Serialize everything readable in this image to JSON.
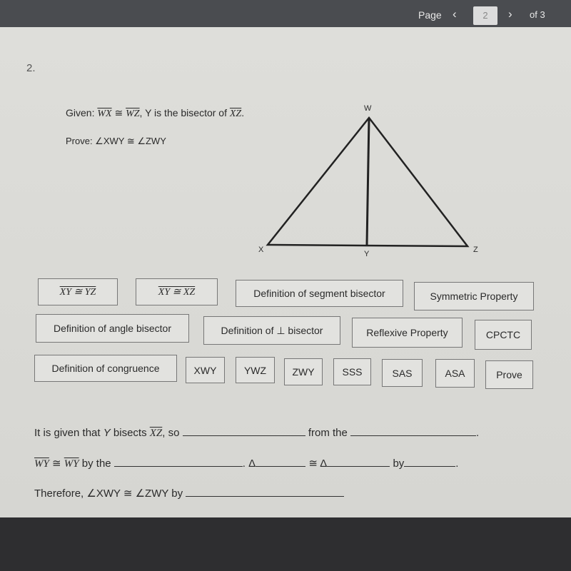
{
  "pager": {
    "label": "Page",
    "current": "2",
    "total": "of 3",
    "prev_icon": "chevron-left-icon",
    "next_icon": "chevron-right-icon"
  },
  "problem": {
    "number": "2.",
    "given_prefix": "Given: ",
    "given_seg1": "WX",
    "given_cong": " ≅ ",
    "given_seg2": "WZ",
    "given_mid": ", Y is the bisector of ",
    "given_seg3": "XZ",
    "given_end": ".",
    "prove": "Prove: ∠XWY ≅ ∠ZWY"
  },
  "diagram": {
    "labels": {
      "W": "W",
      "X": "X",
      "Y": "Y",
      "Z": "Z"
    }
  },
  "choices": [
    {
      "label": "XY ≅ YZ",
      "overline": true
    },
    {
      "label": "XY ≅ XZ",
      "overline": true
    },
    {
      "label": "Definition of segment bisector"
    },
    {
      "label": "Symmetric Property"
    },
    {
      "label": "Definition of angle bisector"
    },
    {
      "label": "Definition of ⊥ bisector"
    },
    {
      "label": "Reflexive Property"
    },
    {
      "label": "CPCTC"
    },
    {
      "label": "Definition of congruence"
    },
    {
      "label": "XWY"
    },
    {
      "label": "YWZ"
    },
    {
      "label": "ZWY"
    },
    {
      "label": "SSS"
    },
    {
      "label": "SAS"
    },
    {
      "label": "ASA"
    },
    {
      "label": "Prove"
    }
  ],
  "proof": {
    "line1_a": "It is given that ",
    "line1_y": "Y",
    "line1_b": " bisects ",
    "line1_seg": "XZ",
    "line1_c": ", so",
    "line1_d": "from the",
    "line1_end": ".",
    "line2_seg1": "WY",
    "line2_cong": " ≅ ",
    "line2_seg2": "WY",
    "line2_a": " by the",
    "line2_b": ". Δ",
    "line2_c": "≅ Δ",
    "line2_d": "by",
    "line2_end": ".",
    "line3": "Therefore, ∠XWY ≅ ∠ZWY by"
  }
}
